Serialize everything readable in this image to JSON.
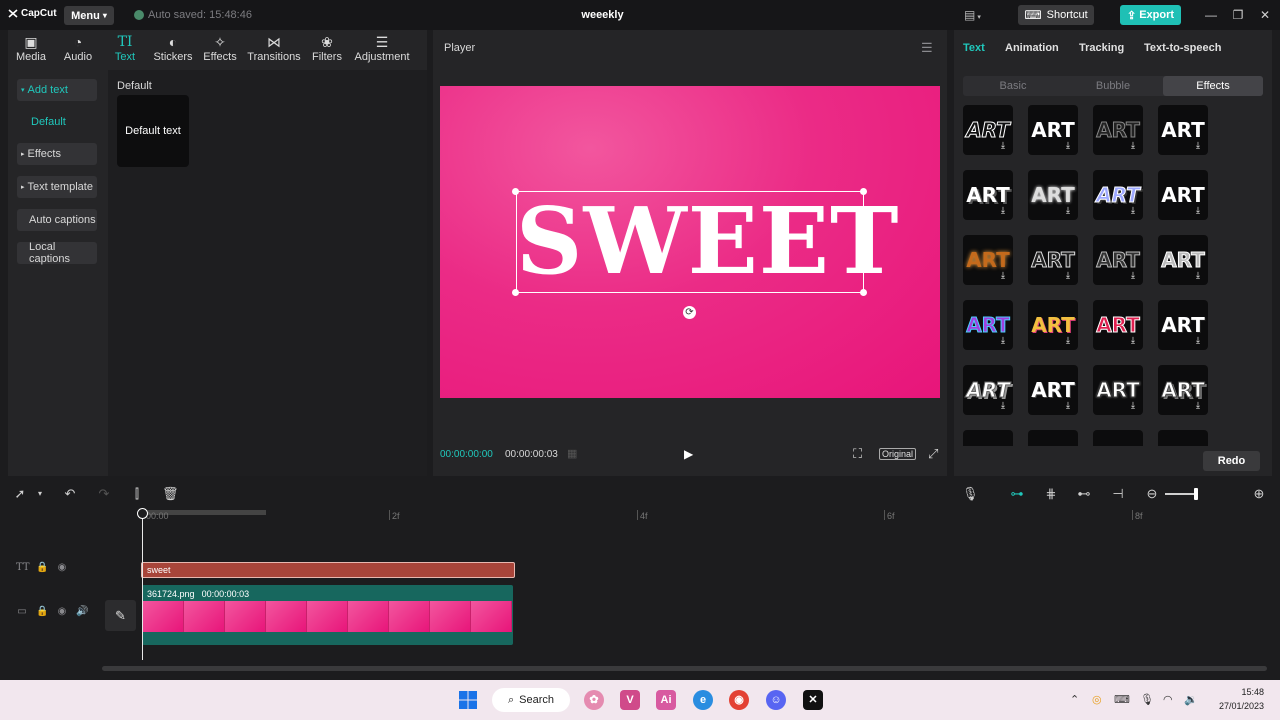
{
  "app": {
    "logo": "CapCut",
    "menu_label": "Menu",
    "autosave": "Auto saved: 15:48:46",
    "project_title": "weeekly",
    "shortcut_label": "Shortcut",
    "export_label": "Export"
  },
  "toolbar": {
    "tabs": [
      {
        "label": "Media"
      },
      {
        "label": "Audio"
      },
      {
        "label": "Text"
      },
      {
        "label": "Stickers"
      },
      {
        "label": "Effects"
      },
      {
        "label": "Transitions"
      },
      {
        "label": "Filters"
      },
      {
        "label": "Adjustment"
      }
    ],
    "text_tab_icon": "TI"
  },
  "sidebar": {
    "items": [
      {
        "label": "Add text"
      },
      {
        "label": "Default"
      },
      {
        "label": "Effects"
      },
      {
        "label": "Text template"
      },
      {
        "label": "Auto captions"
      },
      {
        "label": "Local captions"
      }
    ]
  },
  "content": {
    "section_header": "Default",
    "card_label": "Default text"
  },
  "player": {
    "title": "Player",
    "overlay_text": "SWEET",
    "time_current": "00:00:00:00",
    "time_total": "00:00:00:03",
    "original_label": "Original"
  },
  "right_panel": {
    "tabs": [
      {
        "label": "Text"
      },
      {
        "label": "Animation"
      },
      {
        "label": "Tracking"
      },
      {
        "label": "Text-to-speech"
      }
    ],
    "subtabs": [
      {
        "label": "Basic"
      },
      {
        "label": "Bubble"
      },
      {
        "label": "Effects"
      }
    ],
    "preset_text": "ART",
    "redo_label": "Redo"
  },
  "timeline": {
    "ruler": [
      "00:00",
      "2f",
      "4f",
      "6f",
      "8f"
    ],
    "text_clip_label": "sweet",
    "video_clip_name": "361724.png",
    "video_clip_duration": "00:00:00:03",
    "text_track_icon": "TT"
  },
  "taskbar": {
    "search_label": "Search",
    "time": "15:48",
    "date": "27/01/2023"
  },
  "colors": {
    "accent": "#1fc0b5",
    "canvas_pink": "#e8157a",
    "text_clip": "#a8453a",
    "video_clip": "#17675e"
  }
}
